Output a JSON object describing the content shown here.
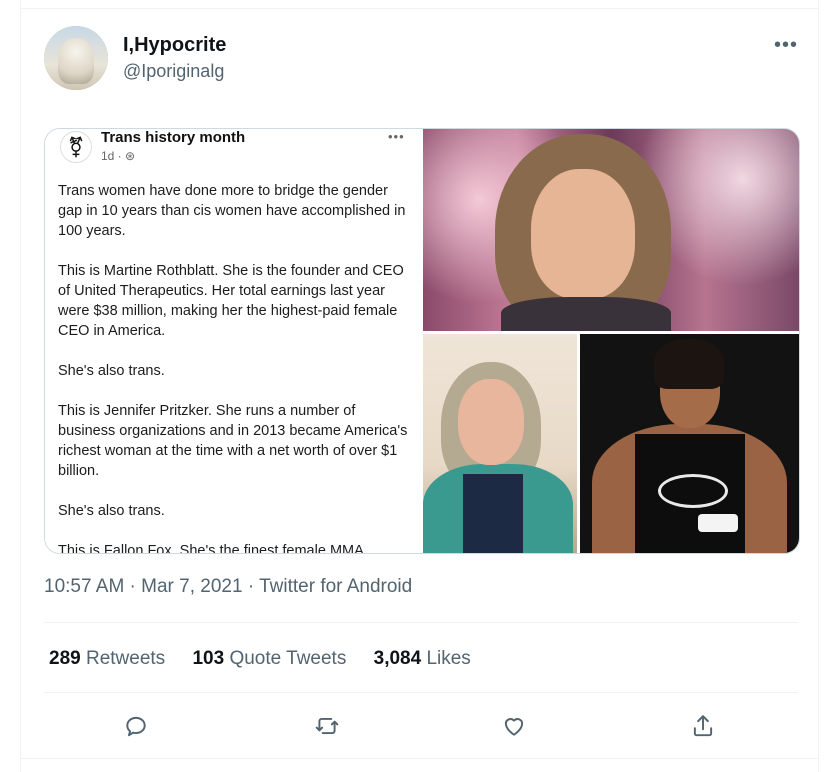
{
  "tweet": {
    "author_name": "I,Hypocrite",
    "author_handle": "@Iporiginalg",
    "more_icon": "more-horizontal-icon",
    "timestamp_line": "10:57 AM · Mar 7, 2021 · Twitter for Android",
    "stats": {
      "retweets_count": "289",
      "retweets_label": "Retweets",
      "quotes_count": "103",
      "quotes_label": "Quote Tweets",
      "likes_count": "3,084",
      "likes_label": "Likes"
    },
    "actions": [
      "reply-icon",
      "retweet-icon",
      "like-icon",
      "share-icon"
    ]
  },
  "embedded_post": {
    "page_name": "Trans history month",
    "time": "1d · ⊛",
    "paragraphs": [
      "Trans women have done more to bridge the gender gap in 10 years than cis women have accomplished in 100 years.",
      "This is Martine Rothblatt. She is the founder and CEO of United Therapeutics. Her total earnings last year were $38 million, making her the highest-paid female CEO in America.",
      "She's also trans.",
      "This is Jennifer Pritzker. She runs a number of business organizations and in 2013 became America's richest woman at the time with a net worth of over $1 billion.",
      "She's also trans.",
      "This is Fallon Fox. She's the finest female MMA"
    ]
  },
  "colors": {
    "primary_text": "#0f1419",
    "secondary_text": "#536471",
    "border": "#eff3f4"
  }
}
